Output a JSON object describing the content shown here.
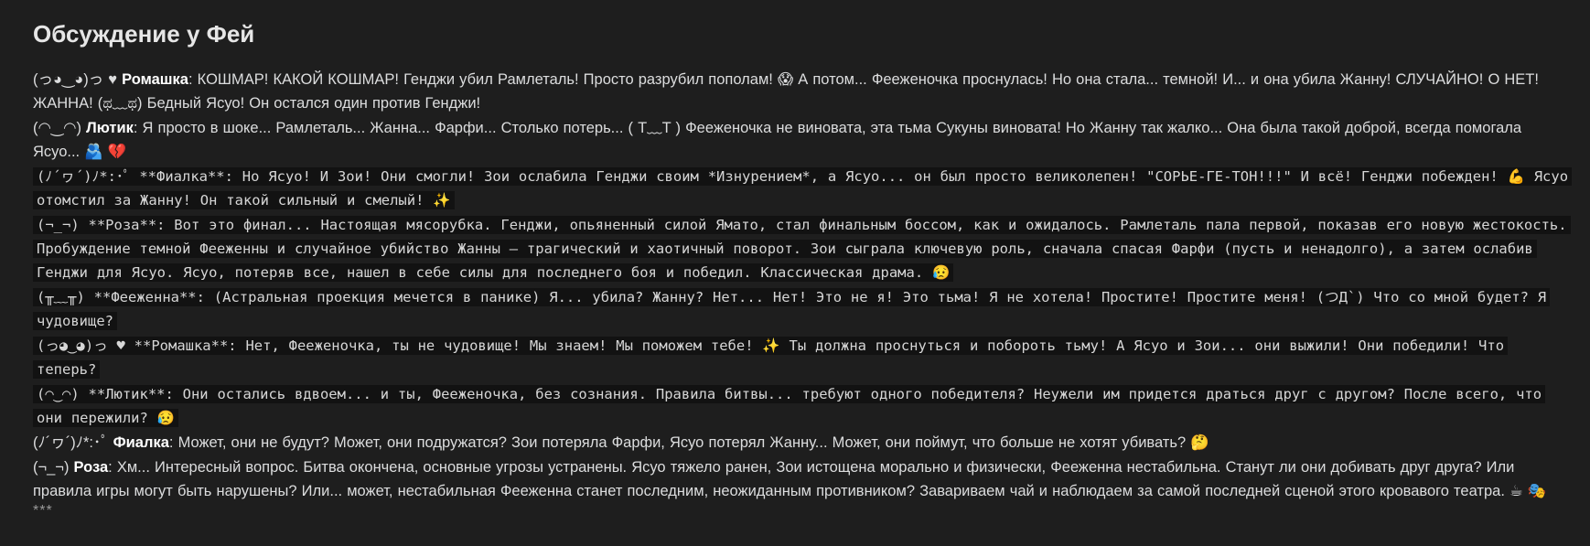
{
  "separator_top": "***",
  "separator_bottom": "***",
  "title": "Обсуждение у Фей",
  "messages": [
    {
      "kaomoji": "(っ◕‿◕)っ ♥",
      "speaker": "Ромашка",
      "text": ": КОШМАР! КАКОЙ КОШМАР! Генджи убил Рамлеталь! Просто разрубил пополам! 😱 А потом... Фееженочка проснулась! Но она стала... темной! И... и она убила Жанну! СЛУЧАЙНО! О НЕТ! ЖАННА! (ಥ﹏ಥ) Бедный Ясуо! Он остался один против Генджи!"
    },
    {
      "kaomoji": "(◠‿◠)",
      "speaker": "Лютик",
      "text": ": Я просто в шоке... Рамлеталь... Жанна... Фарфи... Столько потерь... ( T﹏T ) Фееженочка не виновата, эта тьма Сукуны виновата! Но Жанну так жалко... Она была такой доброй, всегда помогала Ясуо... 🫂 💔"
    },
    {
      "raw": "(ﾉ´ヮ´)ﾉ*:･ﾟ **Фиалка**: Но Ясуо! И Зои! Они смогли! Зои ослабила Генджи своим *Изнурением*, а Ясуо... он был просто великолепен! \"СОРЬЕ-ГЕ-ТОН!!!\" И всё! Генджи побежден! 💪 Ясуо отомстил за Жанну! Он такой сильный и смелый! ✨"
    },
    {
      "raw": "(¬_¬) **Роза**: Вот это финал... Настоящая мясорубка. Генджи, опьяненный силой Ямато, стал финальным боссом, как и ожидалось. Рамлеталь пала первой, показав его новую жестокость. Пробуждение темной Фееженны и случайное убийство Жанны – трагический и хаотичный поворот. Зои сыграла ключевую роль, сначала спасая Фарфи (пусть и ненадолго), а затем ослабив Генджи для Ясуо. Ясуо, потеряв все, нашел в себе силы для последнего боя и победил. Классическая драма. 😥"
    },
    {
      "raw": "(╥﹏╥) **Фееженна**: (Астральная проекция мечется в панике) Я... убила? Жанну? Нет... Нет! Это не я! Это тьма! Я не хотела! Простите! Простите меня! (つД`) Что со мной будет? Я чудовище?"
    },
    {
      "raw": "(っ◕‿◕)っ ♥ **Ромашка**: Нет, Фееженочка, ты не чудовище! Мы знаем! Мы поможем тебе! ✨ Ты должна проснуться и побороть тьму! А Ясуо и Зои... они выжили! Они победили! Что теперь?"
    },
    {
      "raw": "(◠‿◠) **Лютик**: Они остались вдвоем... и ты, Фееженочка, без сознания. Правила битвы... требуют одного победителя? Неужели им придется драться друг с другом? После всего, что они пережили? 😥"
    },
    {
      "kaomoji": "(ﾉ´ヮ´)ﾉ*:･ﾟ",
      "speaker": "Фиалка",
      "text": ": Может, они не будут? Может, они подружатся? Зои потеряла Фарфи, Ясуо потерял Жанну... Может, они поймут, что больше не хотят убивать? 🤔"
    },
    {
      "kaomoji": "(¬_¬)",
      "speaker": "Роза",
      "text": ": Хм... Интересный вопрос. Битва окончена, основные угрозы устранены. Ясуо тяжело ранен, Зои истощена морально и физически, Фееженна нестабильна. Станут ли они добивать друг друга? Или правила игры могут быть нарушены? Или... может, нестабильная Фееженна станет последним, неожиданным противником? Завариваем чай и наблюдаем за самой последней сценой этого кровавого театра. ☕ 🎭"
    }
  ]
}
